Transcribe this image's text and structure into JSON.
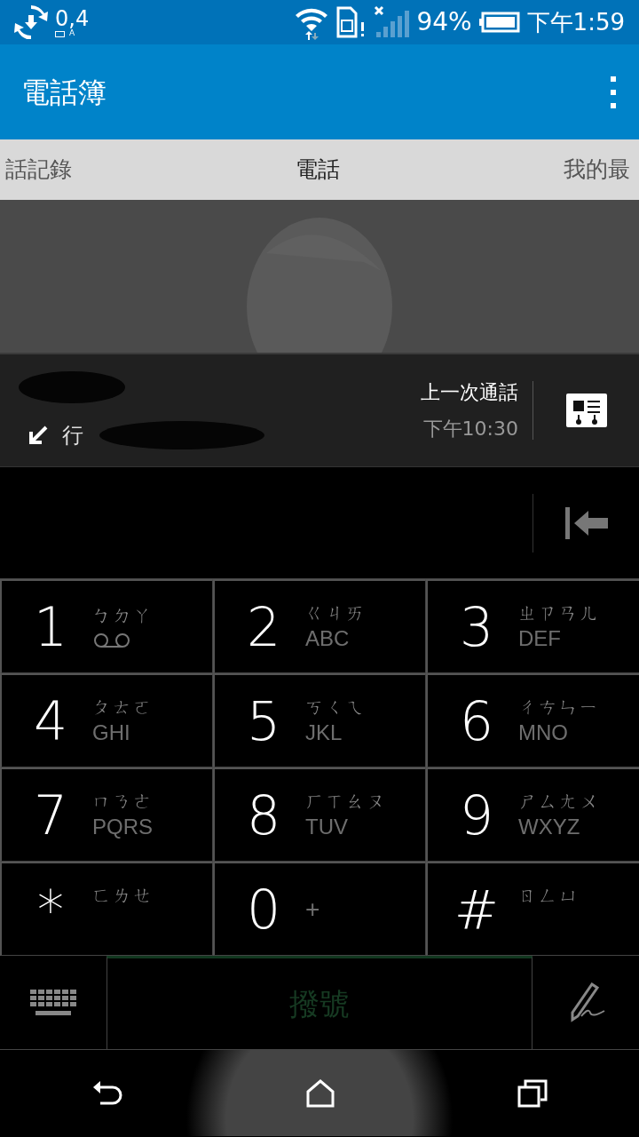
{
  "status_bar": {
    "speed": "0,4",
    "speed_unit": "A",
    "battery": "94%",
    "time": "下午1:59"
  },
  "app_bar": {
    "title": "電話簿"
  },
  "tabs": [
    {
      "label": "話記錄",
      "selected": false
    },
    {
      "label": "電話",
      "selected": true
    },
    {
      "label": "我的最",
      "selected": false
    }
  ],
  "contact": {
    "call_type": "行",
    "last_call_label": "上一次通話",
    "last_call_time": "下午10:30"
  },
  "keypad": [
    {
      "digit": "1",
      "bopomofo": "ㄅㄉㄚ",
      "kind": "voicemail"
    },
    {
      "digit": "2",
      "bopomofo": "ㄍㄐㄞ",
      "letters": "ABC",
      "kind": "letters"
    },
    {
      "digit": "3",
      "bopomofo": "ㄓㄗㄢㄦ",
      "letters": "DEF",
      "kind": "letters"
    },
    {
      "digit": "4",
      "bopomofo": "ㄆㄊㄛ",
      "letters": "GHI",
      "kind": "letters"
    },
    {
      "digit": "5",
      "bopomofo": "ㄎㄑㄟ",
      "letters": "JKL",
      "kind": "letters"
    },
    {
      "digit": "6",
      "bopomofo": "ㄔㄘㄣㄧ",
      "letters": "MNO",
      "kind": "letters"
    },
    {
      "digit": "7",
      "bopomofo": "ㄇㄋㄜ",
      "letters": "PQRS",
      "kind": "letters"
    },
    {
      "digit": "8",
      "bopomofo": "ㄏㄒㄠㄡ",
      "letters": "TUV",
      "kind": "letters"
    },
    {
      "digit": "9",
      "bopomofo": "ㄕㄙㄤㄨ",
      "letters": "WXYZ",
      "kind": "letters"
    },
    {
      "digit": "*",
      "bopomofo": "ㄈㄌㄝ",
      "kind": "plain"
    },
    {
      "digit": "0",
      "letters": "+",
      "kind": "plus"
    },
    {
      "digit": "#",
      "bopomofo": "ㄖㄥㄩ",
      "kind": "plain"
    }
  ],
  "dial_button": {
    "label": "撥號",
    "disabled": true
  }
}
